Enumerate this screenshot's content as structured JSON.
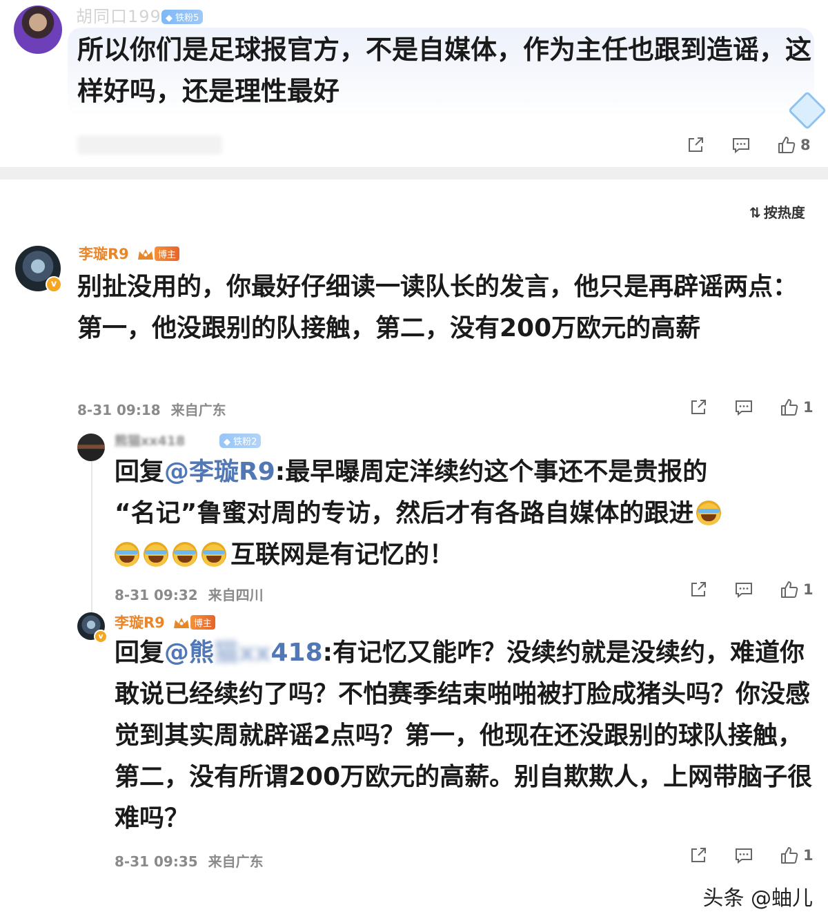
{
  "top_comment": {
    "username": "胡同口1999",
    "fan_badge": "铁粉5",
    "text": "所以你们是足球报官方，不是自媒体，作为主任也跟到造谣，这样好吗，还是理性最好",
    "like_count": "8"
  },
  "sort": {
    "label": "按热度"
  },
  "comments": [
    {
      "username": "李璇R9",
      "badge": "博主",
      "text": "别扯没用的，你最好仔细读一读队长的发言，他只是再辟谣两点：第一，他没跟别的队接触，第二，没有200万欧元的高薪",
      "time": "8-31 09:18",
      "location": "来自广东",
      "like_count": "1"
    }
  ],
  "replies": [
    {
      "username": "熊猫xx418",
      "fan_badge": "铁粉2",
      "reply_prefix": "回复",
      "mention": "@李璇R9",
      "text_line1": ":最早曝周定洋续约这个事还不是贵报的",
      "text_line2": "“名记”鲁蜜对周的专访，然后才有各路自媒体的跟进",
      "text_line3": "互联网是有记忆的！",
      "time": "8-31 09:32",
      "location": "来自四川",
      "like_count": "1"
    },
    {
      "username": "李璇R9",
      "badge": "博主",
      "reply_prefix": "回复",
      "mention_visible": "@熊",
      "mention_blurred": "猫xx",
      "mention_tail": "418",
      "text": ":有记忆又能咋？没续约就是没续约，难道你敢说已经续约了吗？不怕赛季结束啪啪被打脸成猪头吗？你没感觉到其实周就辟谣2点吗？第一，他现在还没跟别的球队接触，第二，没有所谓200万欧元的高薪。别自欺欺人，上网带脑子很难吗？",
      "time": "8-31 09:35",
      "location": "来自广东",
      "like_count": "1"
    }
  ],
  "watermark": "头条 @蚰儿",
  "colors": {
    "accent_orange": "#e8862a",
    "mention_blue": "#5178b5",
    "meta_gray": "#8a8a8a"
  }
}
